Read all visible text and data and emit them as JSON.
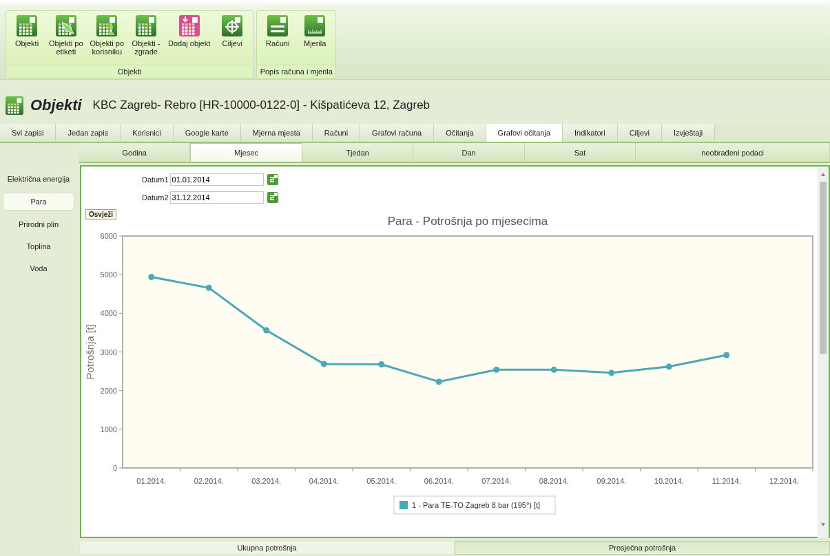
{
  "ribbon": {
    "groups": [
      {
        "label": "Objekti",
        "buttons": [
          {
            "label": "Objekti"
          },
          {
            "label": "Objekti po\netiketi"
          },
          {
            "label": "Objekti po\nkorisniku"
          },
          {
            "label": "Objekti -\nzgrade"
          },
          {
            "label": "Dodaj objekt"
          },
          {
            "label": "Ciljevi"
          }
        ]
      },
      {
        "label": "Popis računa i mjerila",
        "buttons": [
          {
            "label": "Računi"
          },
          {
            "label": "Mjerila"
          }
        ]
      }
    ]
  },
  "header": {
    "title": "Objekti",
    "subtitle": "KBC Zagreb- Rebro [HR-10000-0122-0] - Kišpatićeva 12, Zagreb"
  },
  "tabs": [
    {
      "label": "Svi zapisi",
      "selected": false
    },
    {
      "label": "Jedan zapis",
      "selected": false
    },
    {
      "label": "Korisnici",
      "selected": false
    },
    {
      "label": "Google karte",
      "selected": false
    },
    {
      "label": "Mjerna mjesta",
      "selected": false
    },
    {
      "label": "Računi",
      "selected": false
    },
    {
      "label": "Grafovi računa",
      "selected": false
    },
    {
      "label": "Očitanja",
      "selected": false
    },
    {
      "label": "Grafovi očitanja",
      "selected": true
    },
    {
      "label": "Indikatori",
      "selected": false
    },
    {
      "label": "Ciljevi",
      "selected": false
    },
    {
      "label": "Izvještaji",
      "selected": false
    }
  ],
  "subtabs": [
    {
      "label": "Godina",
      "selected": false
    },
    {
      "label": "Mjesec",
      "selected": true
    },
    {
      "label": "Tjedan",
      "selected": false
    },
    {
      "label": "Dan",
      "selected": false
    },
    {
      "label": "Sat",
      "selected": false
    },
    {
      "label": "neobrađeni podaci",
      "selected": false
    }
  ],
  "sidebar": {
    "items": [
      {
        "label": "Električna energija",
        "selected": false
      },
      {
        "label": "Para",
        "selected": true
      },
      {
        "label": "Prirodni plin",
        "selected": false
      },
      {
        "label": "Toplina",
        "selected": false
      },
      {
        "label": "Voda",
        "selected": false
      }
    ]
  },
  "filters": {
    "date_fields": [
      {
        "label": "Datum1",
        "value": "01.01.2014"
      },
      {
        "label": "Datum2",
        "value": "31.12.2014"
      }
    ],
    "refresh_button": "Osvježi"
  },
  "chart": {
    "chart_data": {
      "type": "line",
      "title": "Para - Potrošnja po mjesecima",
      "ylabel": "Potrošnja [t]",
      "categories": [
        "01.2014.",
        "02.2014.",
        "03.2014.",
        "04.2014.",
        "05.2014.",
        "06.2014.",
        "07.2014.",
        "08.2014.",
        "09.2014.",
        "10.2014.",
        "11.2014.",
        "12.2014."
      ],
      "series": [
        {
          "name": "1 - Para TE-TO Zagreb 8 bar (195°) [t]",
          "color": "#4aa9b8",
          "marker": "circle",
          "values": [
            4940,
            4660,
            3560,
            2690,
            2680,
            2230,
            2540,
            2540,
            2460,
            2620,
            2920,
            null
          ]
        }
      ],
      "ylim": [
        0,
        6000
      ],
      "yticks": [
        0,
        1000,
        2000,
        3000,
        4000,
        5000,
        6000
      ]
    }
  },
  "bottom_tabs": [
    {
      "label": "Ukupna potrošnja",
      "selected": true
    },
    {
      "label": "Prosječna potrošnja",
      "selected": false
    }
  ]
}
